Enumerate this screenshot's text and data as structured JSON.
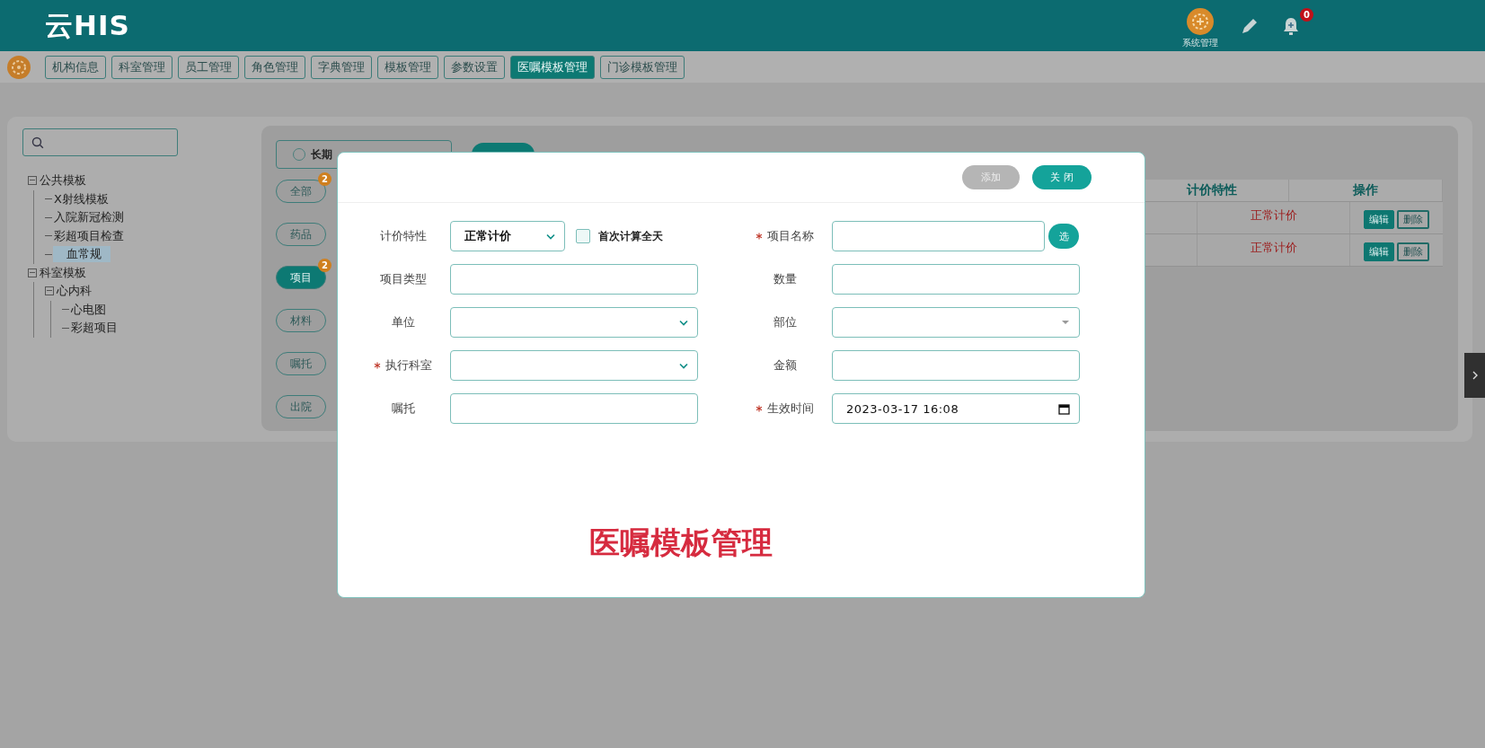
{
  "header": {
    "logo": "云HIS",
    "system_label": "系统管理",
    "notification_count": "0"
  },
  "nav_tabs": [
    {
      "label": "机构信息",
      "selected": false
    },
    {
      "label": "科室管理",
      "selected": false
    },
    {
      "label": "员工管理",
      "selected": false
    },
    {
      "label": "角色管理",
      "selected": false
    },
    {
      "label": "字典管理",
      "selected": false
    },
    {
      "label": "模板管理",
      "selected": false
    },
    {
      "label": "参数设置",
      "selected": false
    },
    {
      "label": "医嘱模板管理",
      "selected": true
    },
    {
      "label": "门诊模板管理",
      "selected": false
    }
  ],
  "tree": [
    {
      "label": "公共模板",
      "expanded": true,
      "selected": false,
      "children": [
        {
          "label": "X射线模板",
          "selected": false
        },
        {
          "label": "入院新冠检测",
          "selected": false
        },
        {
          "label": "彩超项目检查",
          "selected": false
        },
        {
          "label": "血常规",
          "selected": true
        }
      ]
    },
    {
      "label": "科室模板",
      "expanded": true,
      "selected": false,
      "children": [
        {
          "label": "心内科",
          "expanded": true,
          "selected": false,
          "children": [
            {
              "label": "心电图",
              "selected": false
            },
            {
              "label": "彩超项目",
              "selected": false
            }
          ]
        }
      ]
    }
  ],
  "order_types": [
    {
      "label": "长期",
      "selected": false
    }
  ],
  "categories": [
    {
      "label": "全部",
      "badge": "2",
      "selected": false
    },
    {
      "label": "药品",
      "selected": false
    },
    {
      "label": "项目",
      "badge": "2",
      "selected": true
    },
    {
      "label": "材料",
      "selected": false
    },
    {
      "label": "嘱托",
      "selected": false
    },
    {
      "label": "出院",
      "selected": false
    }
  ],
  "table": {
    "columns": [
      "计价特性",
      "操作"
    ],
    "rows": [
      {
        "pricing": "正常计价",
        "actions": [
          "编辑",
          "删除"
        ]
      },
      {
        "pricing": "正常计价",
        "actions": [
          "编辑",
          "删除"
        ]
      }
    ]
  },
  "dialog": {
    "buttons": [
      {
        "label": "添加",
        "disabled": true
      },
      {
        "label": "关 闭",
        "disabled": false
      }
    ],
    "left_fields": [
      {
        "label": "计价特性",
        "required": false,
        "kind": "select",
        "value": "正常计价",
        "checkbox": {
          "label": "首次计算全天",
          "checked": false
        }
      },
      {
        "label": "项目类型",
        "required": false,
        "kind": "text"
      },
      {
        "label": "单位",
        "required": false,
        "kind": "select"
      },
      {
        "label": "执行科室",
        "required": true,
        "kind": "select"
      },
      {
        "label": "嘱托",
        "required": false,
        "kind": "text"
      }
    ],
    "right_fields": [
      {
        "label": "项目名称",
        "required": true,
        "kind": "text",
        "button": "选"
      },
      {
        "label": "数量",
        "required": false,
        "kind": "text"
      },
      {
        "label": "部位",
        "required": false,
        "kind": "combo"
      },
      {
        "label": "金额",
        "required": false,
        "kind": "text"
      },
      {
        "label": "生效时间",
        "required": true,
        "kind": "datetime",
        "value": "2023-03-17 16:08"
      }
    ],
    "caption": "医嘱模板管理"
  }
}
